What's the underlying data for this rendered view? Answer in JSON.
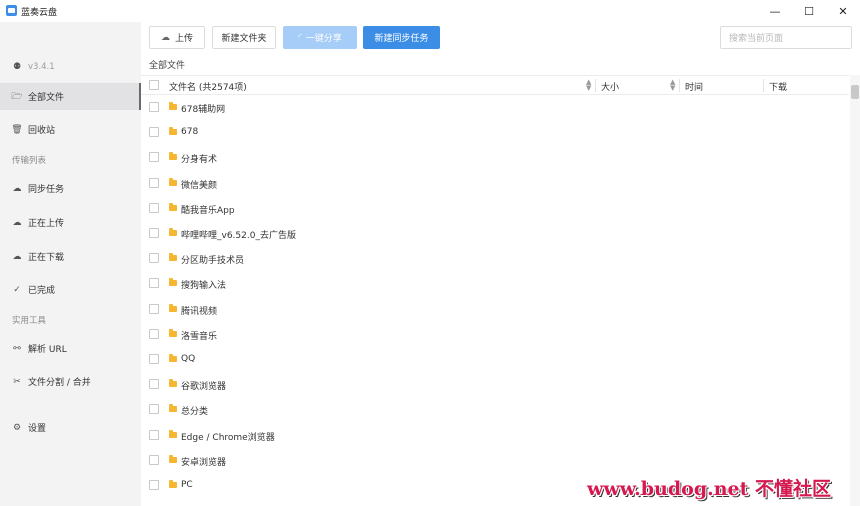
{
  "window": {
    "title": "蓝奏云盘",
    "minimize": "—",
    "maximize": "☐",
    "close": "✕"
  },
  "sidebar": {
    "version": "v3.4.1",
    "sections": {
      "transfer": "传输列表",
      "tools": "实用工具"
    },
    "items": [
      {
        "label": "全部文件",
        "icon": "folder-open-icon",
        "glyph": "🗁"
      },
      {
        "label": "回收站",
        "icon": "trash-icon",
        "glyph": "🗑"
      },
      {
        "label": "同步任务",
        "icon": "sync-icon",
        "glyph": "☁"
      },
      {
        "label": "正在上传",
        "icon": "upload-icon",
        "glyph": "☁"
      },
      {
        "label": "正在下载",
        "icon": "download-icon",
        "glyph": "☁"
      },
      {
        "label": "已完成",
        "icon": "check-circle-icon",
        "glyph": "✓"
      },
      {
        "label": "解析 URL",
        "icon": "link-icon",
        "glyph": "⚯"
      },
      {
        "label": "文件分割 / 合并",
        "icon": "scissors-icon",
        "glyph": "✂"
      },
      {
        "label": "设置",
        "icon": "gear-icon",
        "glyph": "⚙"
      }
    ]
  },
  "toolbar": {
    "upload": "上传",
    "new_folder": "新建文件夹",
    "share": "一键分享",
    "new_sync": "新建同步任务",
    "search_placeholder": "搜索当前页面"
  },
  "breadcrumb": "全部文件",
  "table": {
    "columns": {
      "name": "文件名 (共2574项)",
      "size": "大小",
      "time": "时间",
      "download": "下载"
    },
    "rows": [
      "678辅助网",
      "678",
      "分身有术",
      "微信美颜",
      "酷我音乐App",
      "哔哩哔哩_v6.52.0_去广告版",
      "分区助手技术员",
      "搜狗输入法",
      "腾讯视频",
      "洛雪音乐",
      "QQ",
      "谷歌浏览器",
      "总分类",
      "Edge / Chrome浏览器",
      "安卓浏览器",
      "PC"
    ]
  },
  "watermark": "www.budog.net 不懂社区",
  "colors": {
    "accent": "#3b8de6",
    "accent_disabled": "#a5cdf7",
    "folder": "#f5b731",
    "watermark": "#d5184f"
  }
}
